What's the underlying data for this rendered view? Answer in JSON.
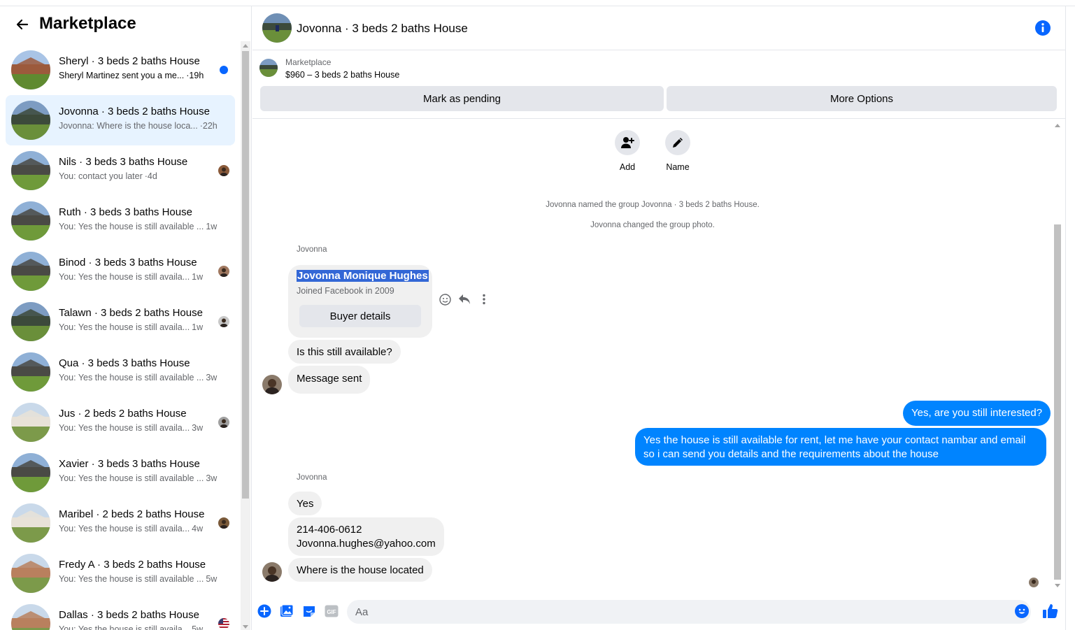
{
  "sidebar": {
    "title": "Marketplace",
    "conversations": [
      {
        "name": "Sheryl · 3 beds 2 baths House",
        "snippet": "Sheryl Martinez sent you a me...",
        "time": "·19h",
        "unread": true
      },
      {
        "name": "Jovonna · 3 beds 2 baths House",
        "snippet": "Jovonna: Where is the house loca...",
        "time": "·22h",
        "active": true
      },
      {
        "name": "Nils · 3 beds 3 baths House",
        "snippet": "You: contact you later",
        "time": "·4d"
      },
      {
        "name": "Ruth · 3 beds 3 baths House",
        "snippet": "You: Yes the house is still available ...",
        "time": "1w"
      },
      {
        "name": "Binod · 3 beds 3 baths House",
        "snippet": "You: Yes the house is still availa...",
        "time": "1w"
      },
      {
        "name": "Talawn · 3 beds 2 baths House",
        "snippet": "You: Yes the house is still availa...",
        "time": "1w"
      },
      {
        "name": "Qua · 3 beds 3 baths House",
        "snippet": "You: Yes the house is still available ...",
        "time": "3w"
      },
      {
        "name": "Jus · 2 beds 2 baths House",
        "snippet": "You: Yes the house is still availa...",
        "time": "3w"
      },
      {
        "name": "Xavier · 3 beds 3 baths House",
        "snippet": "You: Yes the house is still available ...",
        "time": "3w"
      },
      {
        "name": "Maribel · 2 beds 2 baths House",
        "snippet": "You: Yes the house is still availa...",
        "time": "4w"
      },
      {
        "name": "Fredy A · 3 beds 2 baths House",
        "snippet": "You: Yes the house is still available ...",
        "time": "5w"
      },
      {
        "name": "Dallas · 3 beds 2 baths House",
        "snippet": "You: Yes the house is still availa...",
        "time": "5w"
      }
    ]
  },
  "header": {
    "title": "Jovonna · 3 beds 2 baths House"
  },
  "listing": {
    "label": "Marketplace",
    "price_title": "$960 – 3 beds 2 baths House",
    "pending_label": "Mark as pending",
    "more_label": "More Options"
  },
  "actions": {
    "add_label": "Add",
    "name_label": "Name"
  },
  "messages": {
    "sys1": "Jovonna named the group Jovonna · 3 beds 2 baths House.",
    "sys2": "Jovonna changed the group photo.",
    "sender1": "Jovonna",
    "card_name": "Jovonna Monique Hughes",
    "card_sub": "Joined Facebook in 2009",
    "card_button": "Buyer details",
    "m1": "Is this still available?",
    "m2": "Message sent",
    "me1": "Yes, are you still interested?",
    "me2": "Yes the house is still available for rent, let me have your contact nambar and email so i can send you details and the requirements about the house",
    "sender2": "Jovonna",
    "m3": "Yes",
    "m4_phone": "214-406-0612",
    "m4_email": "Jovonna.hughes@yahoo.com",
    "m5": "Where is the house located"
  },
  "composer": {
    "placeholder": "Aa"
  },
  "colors": {
    "accent": "#0084ff",
    "active_bg": "#e7f3ff",
    "bubble_gray": "#f0f0f0"
  }
}
